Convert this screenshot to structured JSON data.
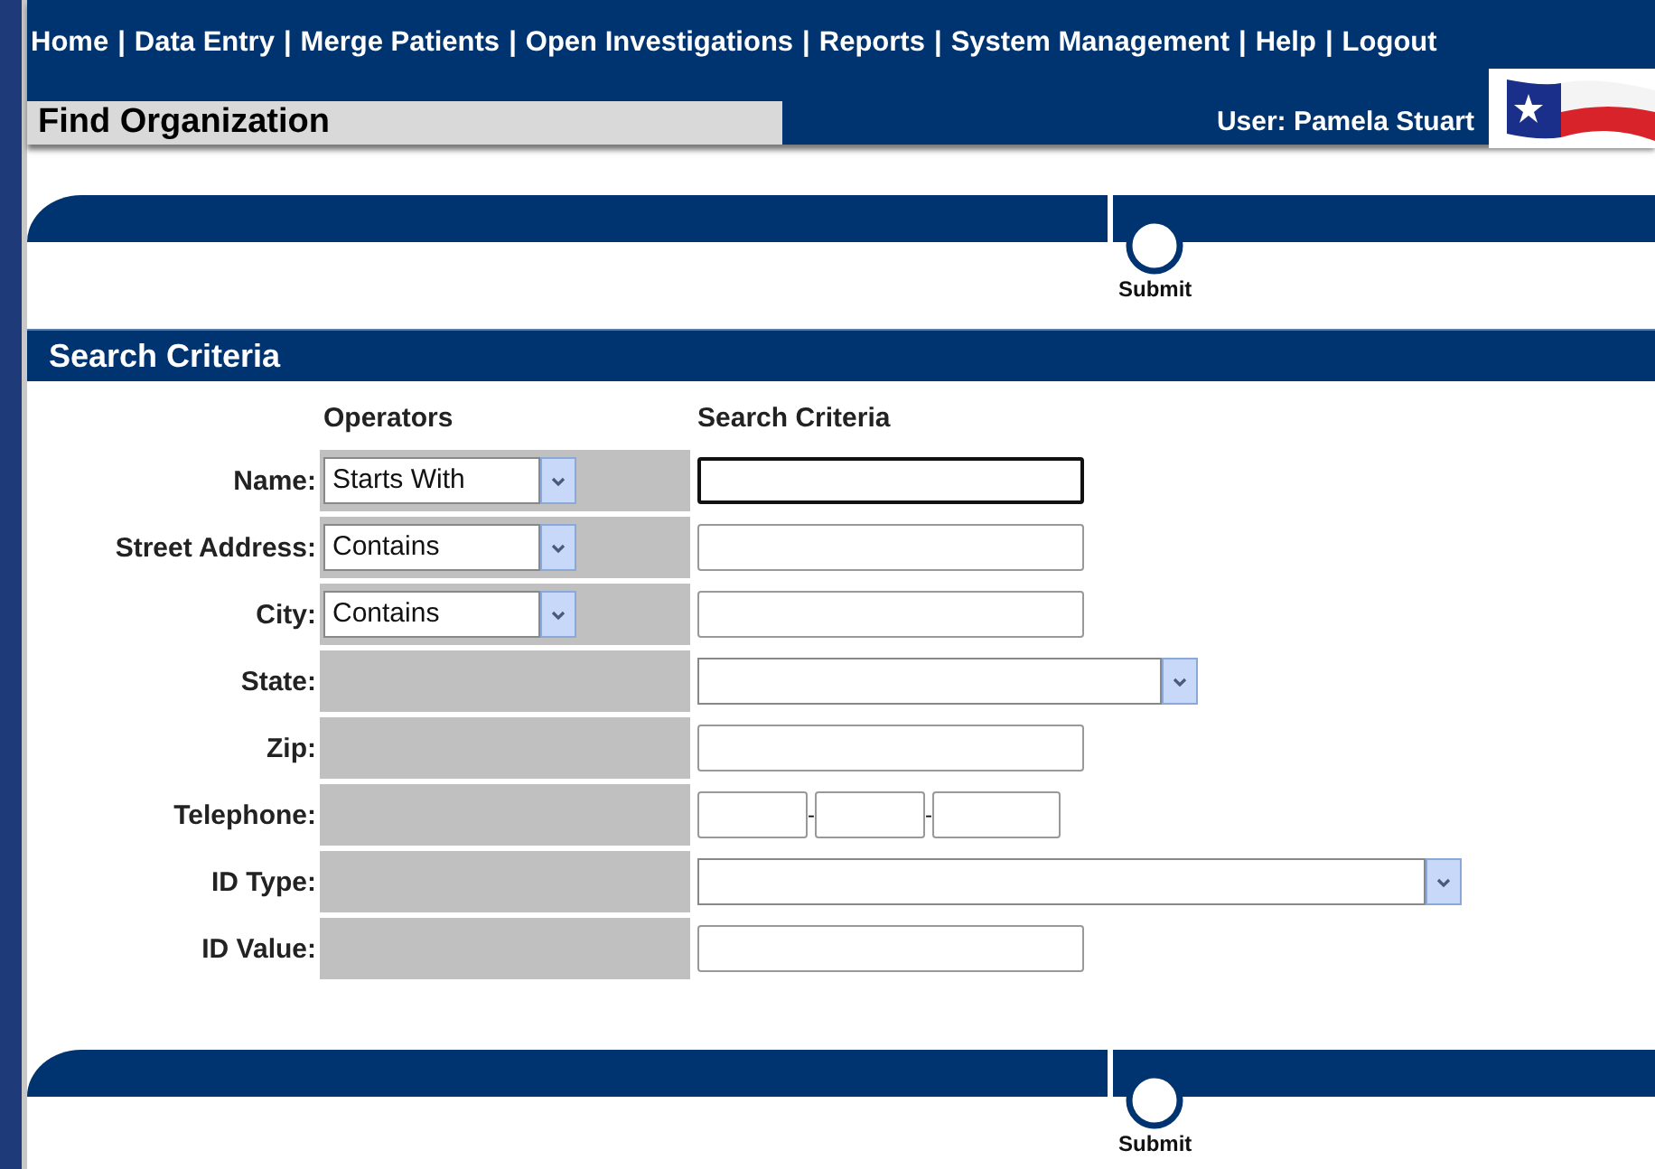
{
  "nav": {
    "separator": "|",
    "items": [
      "Home",
      "Data Entry",
      "Merge Patients",
      "Open Investigations",
      "Reports",
      "System Management",
      "Help",
      "Logout"
    ]
  },
  "page_title": "Find Organization",
  "user": "User: Pamela Stuart",
  "top_toolbar": {
    "button": "Submit"
  },
  "search": {
    "title": "Search Criteria",
    "column_headers": [
      "Operators",
      "Search Criteria"
    ],
    "rows": [
      {
        "label": "Name:",
        "operator": {
          "kind": "select",
          "value": "Starts With"
        },
        "criteria": {
          "kind": "text",
          "focused": true
        }
      },
      {
        "label": "Street Address:",
        "operator": {
          "kind": "select",
          "value": "Contains"
        },
        "criteria": {
          "kind": "text",
          "focused": false
        }
      },
      {
        "label": "City:",
        "operator": {
          "kind": "select",
          "value": "Contains"
        },
        "criteria": {
          "kind": "text",
          "focused": false
        }
      },
      {
        "label": "State:",
        "operator": {
          "kind": "none"
        },
        "criteria": {
          "kind": "select"
        }
      },
      {
        "label": "Zip:",
        "operator": {
          "kind": "none"
        },
        "criteria": {
          "kind": "text",
          "focused": false
        }
      },
      {
        "label": "Telephone:",
        "operator": {
          "kind": "none"
        },
        "criteria": {
          "kind": "phone",
          "separator": "-"
        }
      },
      {
        "label": "ID Type:",
        "operator": {
          "kind": "none"
        },
        "criteria": {
          "kind": "wide-select"
        }
      },
      {
        "label": "ID Value:",
        "operator": {
          "kind": "none"
        },
        "criteria": {
          "kind": "text",
          "focused": false
        }
      }
    ]
  },
  "bottom_toolbar": {
    "button": "Submit"
  }
}
